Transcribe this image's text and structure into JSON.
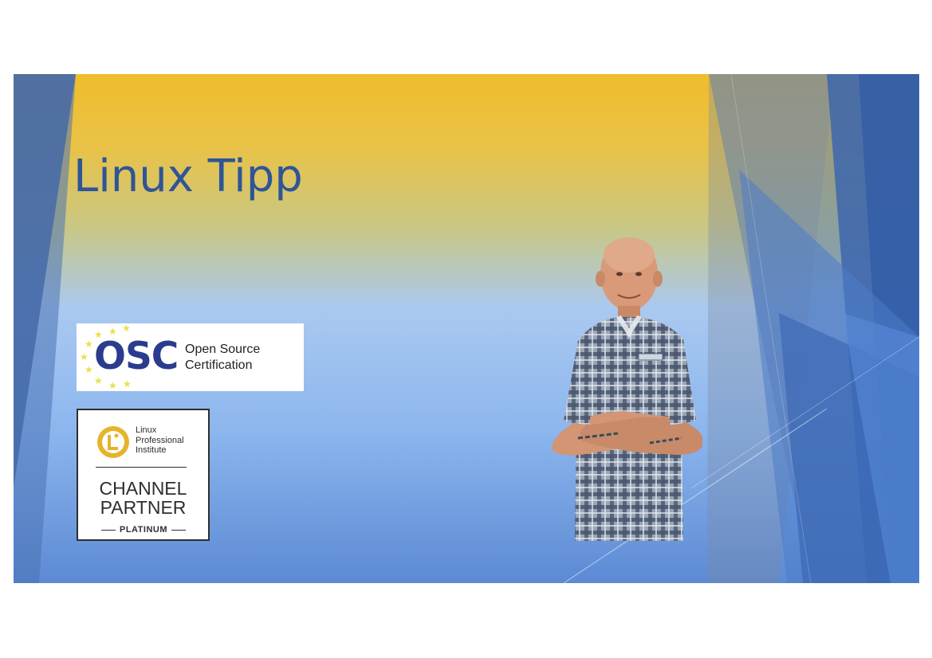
{
  "slide": {
    "title": "Linux Tipp"
  },
  "logos": {
    "osc": {
      "abbrev": "OSC",
      "line1": "Open Source",
      "line2": "Certification",
      "star_color": "#e8e04a",
      "text_color": "#2b3c8f"
    },
    "lpi": {
      "name_line1": "Linux",
      "name_line2": "Professional",
      "name_line3": "Institute",
      "channel_line1": "CHANNEL",
      "channel_line2": "PARTNER",
      "tier": "PLATINUM",
      "icon_color": "#e6b42a"
    }
  },
  "photo": {
    "subject": "presenter-photo"
  },
  "colors": {
    "title": "#2f5597",
    "accent_blue": "#3a6cc6",
    "accent_yellow": "#f0bd2b"
  }
}
